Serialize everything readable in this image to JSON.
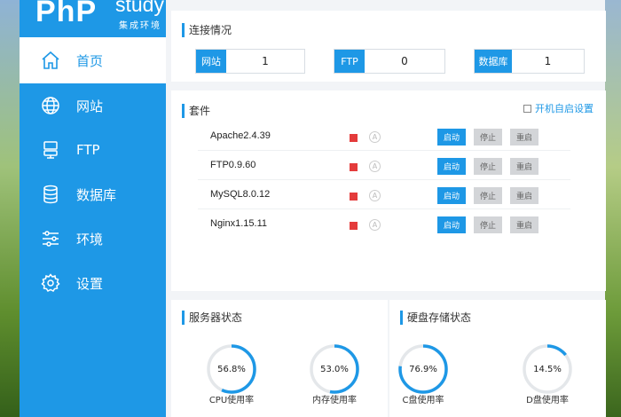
{
  "app": {
    "logo_main": "PhP",
    "logo_study": "study",
    "logo_sub": "集成环境"
  },
  "nav": [
    {
      "label": "首页",
      "icon": "home-icon",
      "active": true
    },
    {
      "label": "网站",
      "icon": "globe-icon",
      "active": false
    },
    {
      "label": "FTP",
      "icon": "server-icon",
      "active": false
    },
    {
      "label": "数据库",
      "icon": "database-icon",
      "active": false
    },
    {
      "label": "环境",
      "icon": "sliders-icon",
      "active": false
    },
    {
      "label": "设置",
      "icon": "gear-icon",
      "active": false
    }
  ],
  "connection": {
    "title": "连接情况",
    "items": [
      {
        "label": "网站",
        "value": "1"
      },
      {
        "label": "FTP",
        "value": "0"
      },
      {
        "label": "数据库",
        "value": "1"
      }
    ]
  },
  "suite": {
    "title": "套件",
    "autostart_label": "开机自启设置",
    "start_label": "启动",
    "stop_label": "停止",
    "restart_label": "重启",
    "auto_glyph": "A",
    "status_color": "#e43b3b",
    "services": [
      {
        "name": "Apache2.4.39"
      },
      {
        "name": "FTP0.9.60"
      },
      {
        "name": "MySQL8.0.12"
      },
      {
        "name": "Nginx1.15.11"
      }
    ]
  },
  "server_status": {
    "title": "服务器状态",
    "gauges": [
      {
        "label": "CPU使用率",
        "value_text": "56.8%",
        "value": 56.8
      },
      {
        "label": "内存使用率",
        "value_text": "53.0%",
        "value": 53.0
      }
    ]
  },
  "disk_status": {
    "title": "硬盘存储状态",
    "gauges": [
      {
        "label": "C盘使用率",
        "value_text": "76.9%",
        "value": 76.9
      },
      {
        "label": "D盘使用率",
        "value_text": "14.5%",
        "value": 14.5
      }
    ]
  },
  "colors": {
    "accent": "#1e98e6",
    "status_stopped": "#e43b3b",
    "button_disabled": "#d3d5d8"
  }
}
